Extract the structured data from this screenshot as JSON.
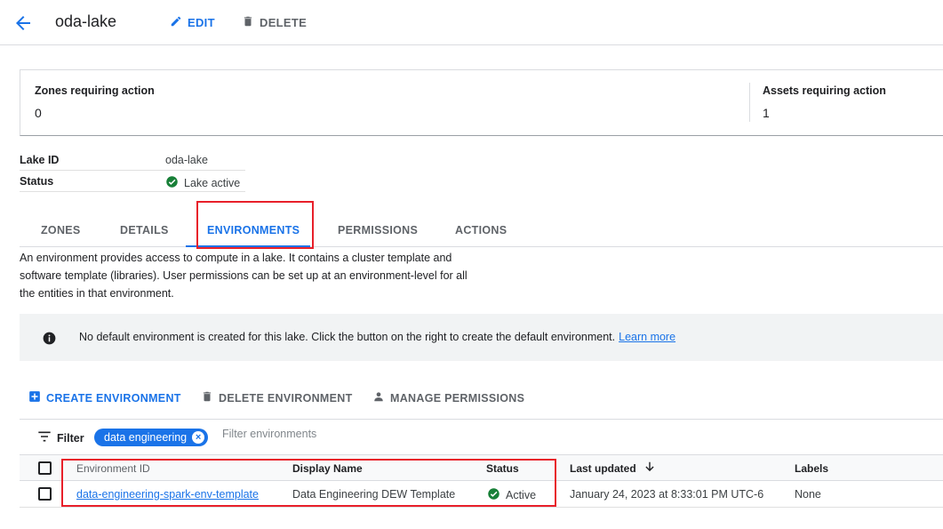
{
  "header": {
    "title": "oda-lake",
    "edit_label": "EDIT",
    "delete_label": "DELETE"
  },
  "summary": {
    "zones_label": "Zones requiring action",
    "zones_value": "0",
    "assets_label": "Assets requiring action",
    "assets_value": "1"
  },
  "details": [
    {
      "key": "Lake ID",
      "value": "oda-lake"
    },
    {
      "key": "Status",
      "value": "Lake active"
    }
  ],
  "tabs": [
    {
      "label": "ZONES"
    },
    {
      "label": "DETAILS"
    },
    {
      "label": "ENVIRONMENTS"
    },
    {
      "label": "PERMISSIONS"
    },
    {
      "label": "ACTIONS"
    }
  ],
  "active_tab": "ENVIRONMENTS",
  "description": "An environment provides access to compute in a lake. It contains a cluster template and software template (libraries). User permissions can be set up at an environment-level for all the entities in that environment.",
  "info": {
    "text": "No default environment is created for this lake. Click the button on the right to create the default environment.",
    "link": "Learn more"
  },
  "actions": {
    "create": "CREATE ENVIRONMENT",
    "delete": "DELETE ENVIRONMENT",
    "manage": "MANAGE PERMISSIONS"
  },
  "filter": {
    "label": "Filter",
    "chip": "data engineering",
    "placeholder": "Filter environments"
  },
  "table": {
    "columns": [
      "Environment ID",
      "Display Name",
      "Status",
      "Last updated",
      "Labels"
    ],
    "rows": [
      {
        "environment_id": "data-engineering-spark-env-template",
        "display_name": "Data Engineering DEW Template",
        "status": "Active",
        "last_updated": "January 24, 2023 at 8:33:01 PM UTC-6",
        "labels": "None"
      }
    ]
  },
  "colors": {
    "accent": "#1a73e8",
    "success": "#188038",
    "highlight": "#e8202a"
  }
}
